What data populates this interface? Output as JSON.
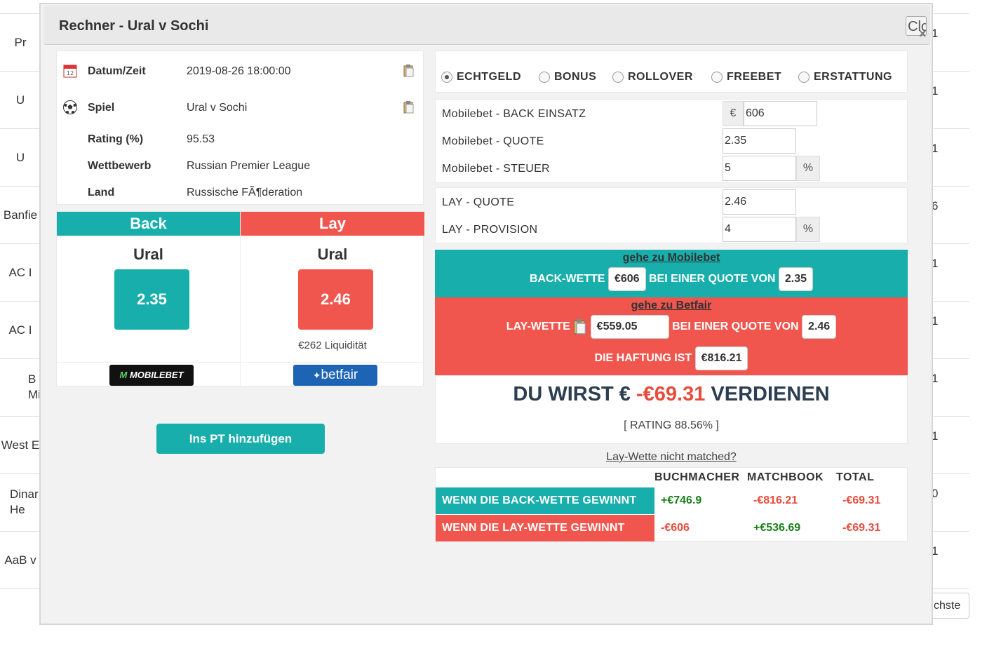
{
  "background": {
    "rows": [
      {
        "left": "Pr",
        "right": "1"
      },
      {
        "left": "U",
        "right": "1"
      },
      {
        "left": "U",
        "right": "1"
      },
      {
        "left": "Banfie",
        "right": "6"
      },
      {
        "left": "AC I",
        "right": "1"
      },
      {
        "left": "AC I",
        "right": "1"
      },
      {
        "left": "B Mi",
        "right": "1"
      },
      {
        "left": "West E",
        "right": "1"
      },
      {
        "left": "Dinar He",
        "right": "0"
      },
      {
        "left": "AaB v",
        "right": "1"
      }
    ],
    "next_button": "chste"
  },
  "modal": {
    "title": "Rechner - Ural v Sochi",
    "close_label": "Close",
    "close_x": "×"
  },
  "info": {
    "datetime_label": "Datum/Zeit",
    "datetime_value": "2019-08-26 18:00:00",
    "game_label": "Spiel",
    "game_value": "Ural v Sochi",
    "rating_label": "Rating (%)",
    "rating_value": "95.53",
    "competition_label": "Wettbewerb",
    "competition_value": "Russian Premier League",
    "country_label": "Land",
    "country_value": "Russische FÃ¶deration"
  },
  "backlay": {
    "back_header": "Back",
    "lay_header": "Lay",
    "back_team": "Ural",
    "lay_team": "Ural",
    "back_odds": "2.35",
    "lay_odds": "2.46",
    "liquidity": "€262 Liquidität",
    "back_logo": "MOBILEBET",
    "lay_logo": "betfair",
    "back_color": "#17aeab",
    "lay_color": "#f0564d"
  },
  "add_pt_button": "Ins PT hinzufügen",
  "radio": {
    "options": [
      "ECHTGELD",
      "BONUS",
      "ROLLOVER",
      "FREEBET",
      "ERSTATTUNG"
    ],
    "selected": "ECHTGELD"
  },
  "inputs": {
    "back_stake_label": "Mobilebet - BACK EINSATZ",
    "currency_addon": "€",
    "back_stake_value": "606",
    "back_odds_label": "Mobilebet - QUOTE",
    "back_odds_value": "2.35",
    "tax_label": "Mobilebet - STEUER",
    "tax_value": "5",
    "percent_addon": "%",
    "lay_odds_label": "LAY - QUOTE",
    "lay_odds_value": "2.46",
    "commission_label": "LAY - PROVISION",
    "commission_value": "4"
  },
  "result": {
    "goto_back": "gehe zu Mobilebet",
    "back_bet_label": "BACK-WETTE",
    "back_bet_value": "€606",
    "at_odds_label": "BEI EINER QUOTE VON",
    "back_bet_odds": "2.35",
    "goto_lay": "gehe zu Betfair",
    "lay_bet_label": "LAY-WETTE",
    "lay_bet_value": "€559.05",
    "lay_bet_odds": "2.46",
    "liability_label": "DIE HAFTUNG IST",
    "liability_value": "€816.21",
    "earn_prefix": "DU WIRST €",
    "earn_value": "-€69.31",
    "earn_suffix": "VERDIENEN",
    "rating": "[ RATING 88.56% ]"
  },
  "unmatched_link": "Lay-Wette nicht matched?",
  "outcomes": {
    "headers": [
      "BUCHMACHER",
      "MATCHBOOK",
      "TOTAL"
    ],
    "rows": [
      {
        "label": "WENN DIE BACK-WETTE GEWINNT",
        "bookmaker": "+€746.9",
        "matchbook": "-€816.21",
        "total": "-€69.31"
      },
      {
        "label": "WENN DIE LAY-WETTE GEWINNT",
        "bookmaker": "-€606",
        "matchbook": "+€536.69",
        "total": "-€69.31"
      }
    ]
  }
}
